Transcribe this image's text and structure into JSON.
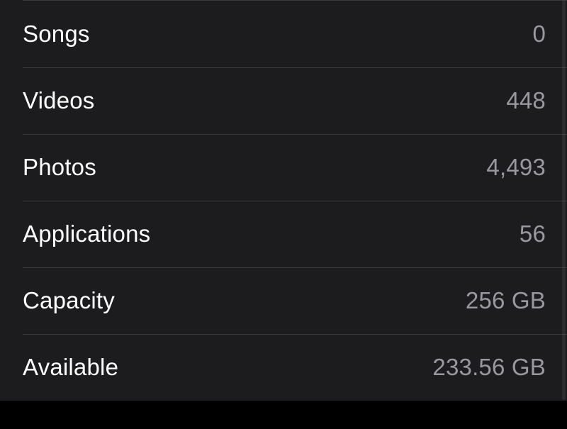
{
  "rows": [
    {
      "label": "Songs",
      "value": "0"
    },
    {
      "label": "Videos",
      "value": "448"
    },
    {
      "label": "Photos",
      "value": "4,493"
    },
    {
      "label": "Applications",
      "value": "56"
    },
    {
      "label": "Capacity",
      "value": "256 GB"
    },
    {
      "label": "Available",
      "value": "233.56 GB"
    }
  ]
}
